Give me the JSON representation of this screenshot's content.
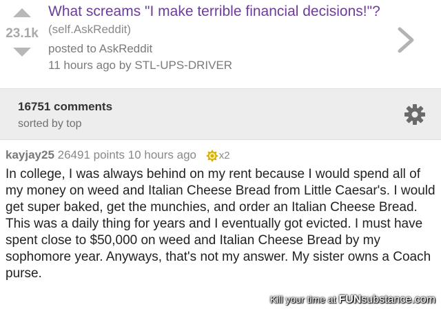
{
  "post": {
    "score": "23.1k",
    "title": "What screams \"I make terrible financial decisions!\"?",
    "domain": "(self.AskReddit)",
    "posted_to": "posted to AskReddit",
    "byline": "11 hours ago by STL-UPS-DRIVER"
  },
  "comments_bar": {
    "count": "16751 comments",
    "sort": "sorted by top"
  },
  "comment": {
    "author": "kayjay25",
    "points": "26491 points",
    "age": "10 hours ago",
    "gilded": "x2",
    "text": "In college, I was always behind on my rent because I would spend all of my money on weed and Italian Cheese Bread from Little Caesar's. I would get super baked, get the munchies, and order an Italian Cheese Bread. This was a daily thing for years and I eventually got evicted. I must have spent close to $50,000 on weed and Italian Cheese Bread by my sophomore year. Anyways, that's not my answer. My sister owns a Coach purse."
  },
  "watermark": {
    "prefix": "Kill your time at",
    "fun": "FUN",
    "substance": "substance",
    "dotcom": ".com"
  },
  "colors": {
    "title": "#6b3d99",
    "vote_arrow": "#b8b8b8",
    "bar_bg": "#ededed",
    "gold": "#d6b000"
  },
  "icons": [
    "upvote-arrow-icon",
    "downvote-arrow-icon",
    "chevron-right-icon",
    "gear-icon",
    "gold-award-icon"
  ]
}
